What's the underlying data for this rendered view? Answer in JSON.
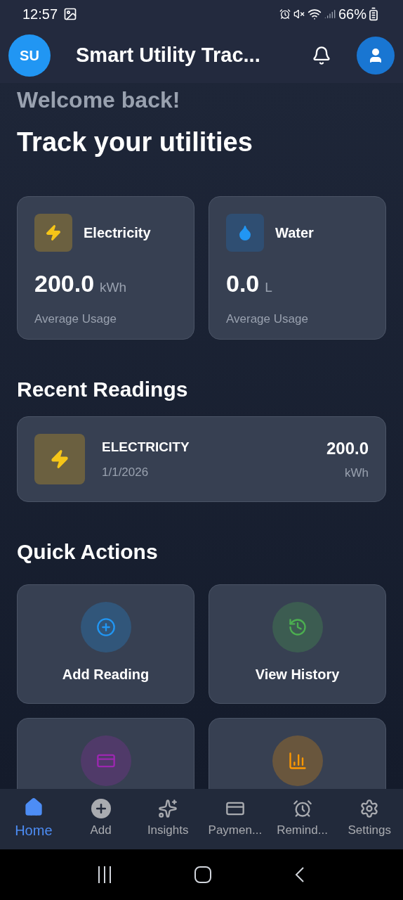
{
  "status_bar": {
    "time": "12:57",
    "battery": "66%"
  },
  "app_bar": {
    "avatar": "SU",
    "title": "Smart Utility Trac..."
  },
  "greeting": "Welcome back!",
  "headline": "Track your utilities",
  "summary": [
    {
      "kind": "electricity",
      "label": "Electricity",
      "value": "200.0",
      "unit": "kWh",
      "caption": "Average Usage"
    },
    {
      "kind": "water",
      "label": "Water",
      "value": "0.0",
      "unit": "L",
      "caption": "Average Usage"
    }
  ],
  "recent_title": "Recent Readings",
  "readings": [
    {
      "kind": "electricity",
      "type": "ELECTRICITY",
      "date": "1/1/2026",
      "value": "200.0",
      "unit": "kWh"
    }
  ],
  "actions_title": "Quick Actions",
  "quick_actions": [
    {
      "kind": "add",
      "label": "Add Reading",
      "color": "#2196f3"
    },
    {
      "kind": "history",
      "label": "View History",
      "color": "#4caf50"
    },
    {
      "kind": "card",
      "color": "#9c27b0"
    },
    {
      "kind": "chart",
      "color": "#ff9800"
    }
  ],
  "bottom_nav": [
    {
      "kind": "home",
      "label": "Home",
      "selected": true
    },
    {
      "kind": "add",
      "label": "Add",
      "selected": false
    },
    {
      "kind": "insights",
      "label": "Insights",
      "selected": false
    },
    {
      "kind": "card",
      "label": "Paymen...",
      "selected": false
    },
    {
      "kind": "alarm",
      "label": "Remind...",
      "selected": false
    },
    {
      "kind": "settings",
      "label": "Settings",
      "selected": false
    }
  ]
}
